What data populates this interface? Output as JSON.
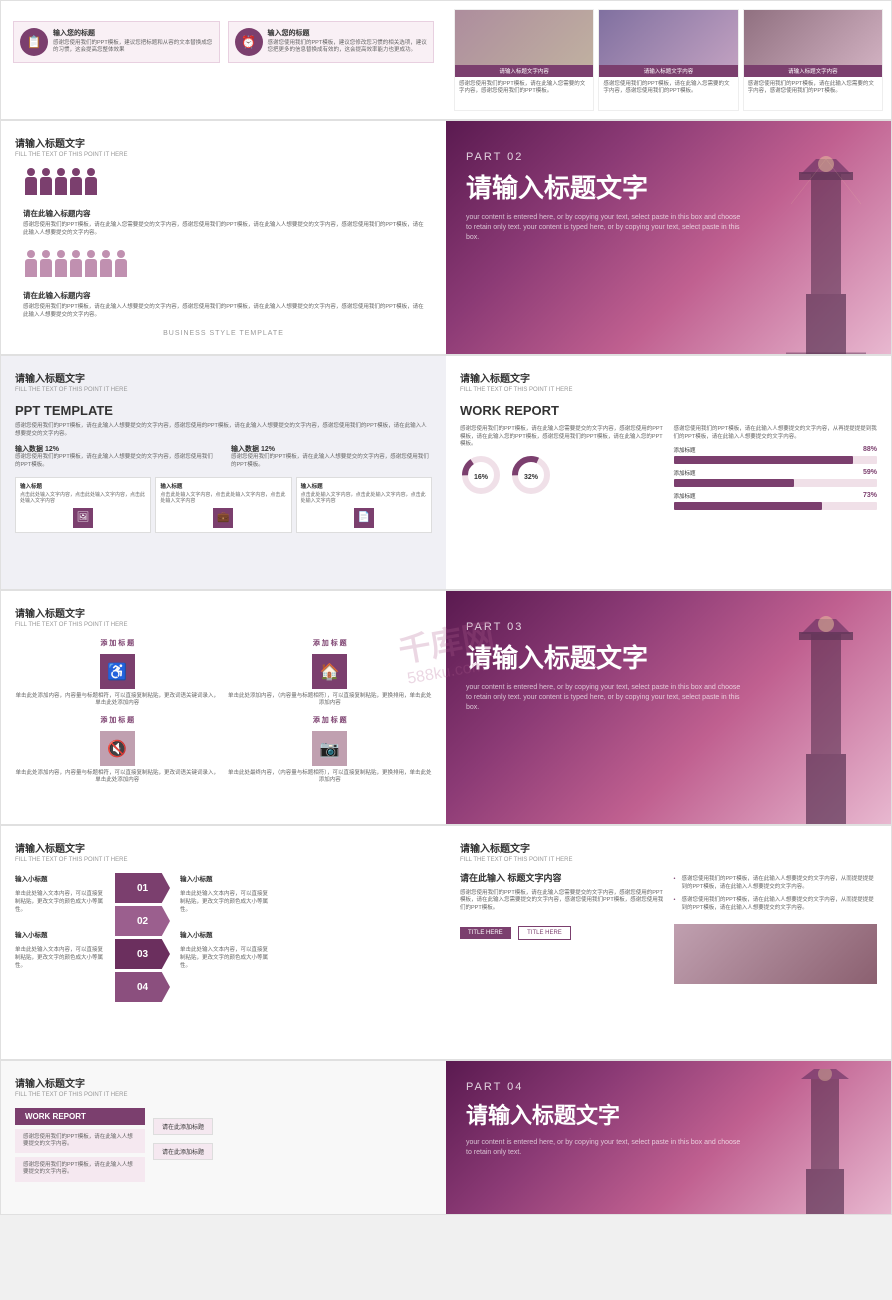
{
  "watermark": {
    "line1": "千库网",
    "line2": "588ku.com"
  },
  "slides": {
    "row1": {
      "left": {
        "icons": [
          {
            "icon": "📋",
            "title": "输入您的标题",
            "desc": "感谢您使用我们的PPT模板，建议您把标题和从容的文本替换成您的习惯，这会提高您整体效果"
          },
          {
            "icon": "⏰",
            "title": "输入您的标题",
            "desc": "感谢您使用我们的PPT模板，建议您修改您习惯的相关选项，建议您把更多的信息替换成有效的，这会提高效率能力也更成功。"
          }
        ]
      },
      "right": {
        "cards": [
          {
            "label": "请输入标题文字内容",
            "desc": "感谢您使用我们的PPT模板，请在此输入您需要的文字内容，感谢您使用我们的PPT模板。"
          },
          {
            "label": "请输入标题文字内容",
            "desc": "感谢您使用我们的PPT模板，请在此输入您需要的文字内容，感谢您使用我们的PPT模板。"
          },
          {
            "label": "请输入标题文字内容",
            "desc": "感谢您使用我们的PPT模板，请在此输入您需要的文字内容，感谢您使用我们的PPT模板。"
          }
        ]
      }
    },
    "row2": {
      "left": {
        "title": "请输入标题文字",
        "subtitle": "FILL THE TEXT OF THIS POINT IT HERE",
        "heading1": "请在此输入标题内容",
        "text1": "感谢您使用我们的PPT模板，请在此输入您需要提交的文字内容，感谢您使用我们的PPT模板，请在此输入人想要提交的文字内容，感谢您使用我们的PPT模板，请在此输入人想要提交的文字内容。",
        "heading2": "请在此输入标题内容",
        "text2": "感谢您使用我们的PPT模板，请在此输入人想要提交的文字内容，感谢您使用我们的PPT模板，请在此输入人想要提交的文字内容，感谢您使用我们的PPT模板，请在此输入人想要提交的文字内容。",
        "business_label": "BUSINESS STYLE TEMPLATE"
      },
      "right": {
        "part": "PART 02",
        "title": "请输入标题文字",
        "desc": "your content is entered here, or by copying your text, select paste in this box and choose to retain only text. your content is typed here, or by copying your text, select paste in this box."
      }
    },
    "row3": {
      "left": {
        "title": "请输入标题文字",
        "subtitle": "FILL THE TEXT OF THIS POINT IT HERE",
        "main_title": "PPT TEMPLATE",
        "intro_text": "感谢您使用我们的PPT模板，请在此输入人想要提交的文字内容，感谢您使用的PPT模板，请在此输入人想要提交的文字内容，感谢您使用我们的PPT模板，请在此输入人想要提交的文字内容。",
        "data_label1": "输入数据 12%",
        "data_text1": "感谢您使用我们的PPT模板，请在此输入人想要提交的文字内容，感谢您使用我们的PPT模板。",
        "data_label2": "输入数据 12%",
        "data_text2": "感谢您使用我们的PPT模板，请在此输入人想要提交的文字内容，感谢您使用我们的PPT模板。",
        "mini_cards": [
          {
            "title": "输入标题",
            "desc": "点击此处输入文字内容，点击此处输入文字内容，点击此处输入文字内容",
            "icon": "🖼"
          },
          {
            "title": "输入标题",
            "desc": "点击此处输入文字内容，点击此处输入文字内容，点击此处输入文字内容",
            "icon": "💼"
          },
          {
            "title": "输入标题",
            "desc": "点击此处输入文字内容，点击此处输入文字内容，点击此处输入文字内容",
            "icon": "📄"
          }
        ]
      },
      "right": {
        "title": "请输入标题文字",
        "subtitle": "FILL THE TEXT OF THIS POINT IT HERE",
        "main_title": "WORK REPORT",
        "left_text": "感谢您使用我们的PPT模板，请在此输入您需要提交的文字内容，感谢您使用的PPT模板，请在此输入您的PPT模板，感谢您使用我们的PPT模板，请在此输入您的PPT模板。",
        "right_text": "感谢您使用我们的PPT模板，请在此输入人想要提交的文字内容，从再提提提提到我们的PPT模板，请在此输入人想要提交的文字内容。",
        "pie1": {
          "value": "16",
          "unit": "%"
        },
        "pie2": {
          "value": "32",
          "unit": "%"
        },
        "bars": [
          {
            "label": "添加标题",
            "value": 88,
            "text": "88%"
          },
          {
            "label": "添加标题",
            "value": 59,
            "text": "59%"
          },
          {
            "label": "添加标题",
            "value": 73,
            "text": "73%"
          }
        ]
      }
    },
    "row4": {
      "left": {
        "title": "请输入标题文字",
        "subtitle": "FILL THE TEXT OF THIS POINT IT HERE",
        "icons": [
          {
            "icon": "♿",
            "label": "添加标题",
            "desc": "单击此处添加内容，内容量与标题相符，可以直接复制粘贴，更改词语关键词录入，单击此处添加内容"
          },
          {
            "icon": "🏠",
            "label": "添加标题",
            "desc": "单击此处添加内容，（内容量与标题相符），可以直接复制粘贴，更换排用，单击此处添加内容"
          },
          {
            "icon": "🔇",
            "label": "添加标题",
            "desc": "单击此处添加内容，内容量与标题相符，可以直接复制粘贴，更改词语关键词录入，单击此处添加内容"
          },
          {
            "icon": "📷",
            "label": "添加标题",
            "desc": "单击此处最终内容，（内容量与标题相符），可以直接复制粘贴，更换排用，单击此处添加内容"
          }
        ]
      },
      "right": {
        "part": "PART 03",
        "title": "请输入标题文字",
        "desc": "your content is entered here, or by copying your text, select paste in this box and choose to retain only text. your content is typed here, or by copying your text, select paste in this box."
      }
    },
    "row5": {
      "left": {
        "title": "请输入标题文字",
        "subtitle": "FILL THE TEXT OF THIS POINT IT HERE",
        "arrows": [
          {
            "num": "01",
            "title": "输入小标题",
            "desc": "单击此处输入文本内容，可以直接复制粘贴，更改文字的颜色成大小等属性。"
          },
          {
            "num": "02",
            "title": "输入小标题",
            "desc": "单击此处输入文本内容，可以直接复制粘贴，更改文字的颜色成大小等属性。"
          },
          {
            "num": "03",
            "title": "输入小标题",
            "desc": "单击此处输入文本内容，可以直接复制粘贴，更改文字的颜色成大小等属性。"
          },
          {
            "num": "04",
            "title": "输入小标题",
            "desc": "单击此处输入文本内容，可以直接复制粘贴，更改文字的颜色成大小等属性。"
          }
        ]
      },
      "right": {
        "title": "请输入标题文字",
        "subtitle": "FILL THE TEXT OF THIS POINT IT HERE",
        "main_title": "请在此输入\n标题文字内容",
        "body_text": "感谢您使用我们的PPT模板，请在此输入您需要提交的文字内容，感谢您使用的PPT模板，请在此输入您需要提交的文字内容，感谢您使用我们PPT模板，感谢您使用我们的PPT模板。",
        "bullet_items": [
          "感谢您使用我们的PPT模板，请在此输入人想要提交的文字内容，从而提提提提到的PPT模板，请在此输入人想要提交的文字内容。",
          "感谢您使用我们的PPT模板，请在此输入人想要提交的文字内容，从而提提提提到的PPT模板，请在此输入人想要提交的文字内容。"
        ],
        "btn1": "TITLE HERE",
        "btn2": "TITLE HERE"
      }
    },
    "row6": {
      "left": {
        "title": "请输入标题文字",
        "subtitle": "FILL THE TEXT OF THIS POINT IT HERE",
        "work_report_label": "WORK REPORT",
        "texts": [
          "感谢您使用我们的PPT模板，请在此输入人想要提交的文字内容。",
          "感谢您使用我们的PPT模板，请在此输入人想要提交的文字内容。"
        ],
        "pointer_labels": [
          "请在此添加标题",
          "请在此添加标题"
        ]
      },
      "right": {
        "part": "PART 04",
        "title": "请输入标题文字",
        "desc": "your content is entered here, or by copying your text, select paste in this box and choose to retain only text."
      }
    }
  }
}
